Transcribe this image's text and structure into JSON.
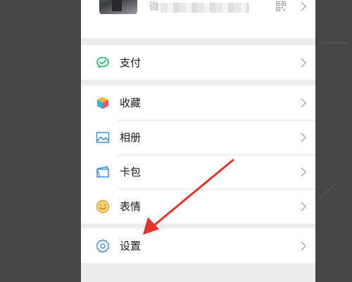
{
  "profile": {
    "wechat_id_prefix": "微"
  },
  "menu": {
    "pay": {
      "label": "支付",
      "icon": "wechat-pay-icon"
    },
    "favorites": {
      "label": "收藏",
      "icon": "favorites-cube-icon"
    },
    "album": {
      "label": "相册",
      "icon": "album-icon"
    },
    "cards": {
      "label": "卡包",
      "icon": "card-wallet-icon"
    },
    "stickers": {
      "label": "表情",
      "icon": "emoji-smile-icon"
    },
    "settings": {
      "label": "设置",
      "icon": "gear-icon"
    }
  },
  "colors": {
    "pay_green": "#07c160",
    "album_blue": "#3b8fe8",
    "sticker_orange": "#f0a030",
    "settings_blue": "#4a90e2",
    "annotation_red": "#e8332a"
  }
}
